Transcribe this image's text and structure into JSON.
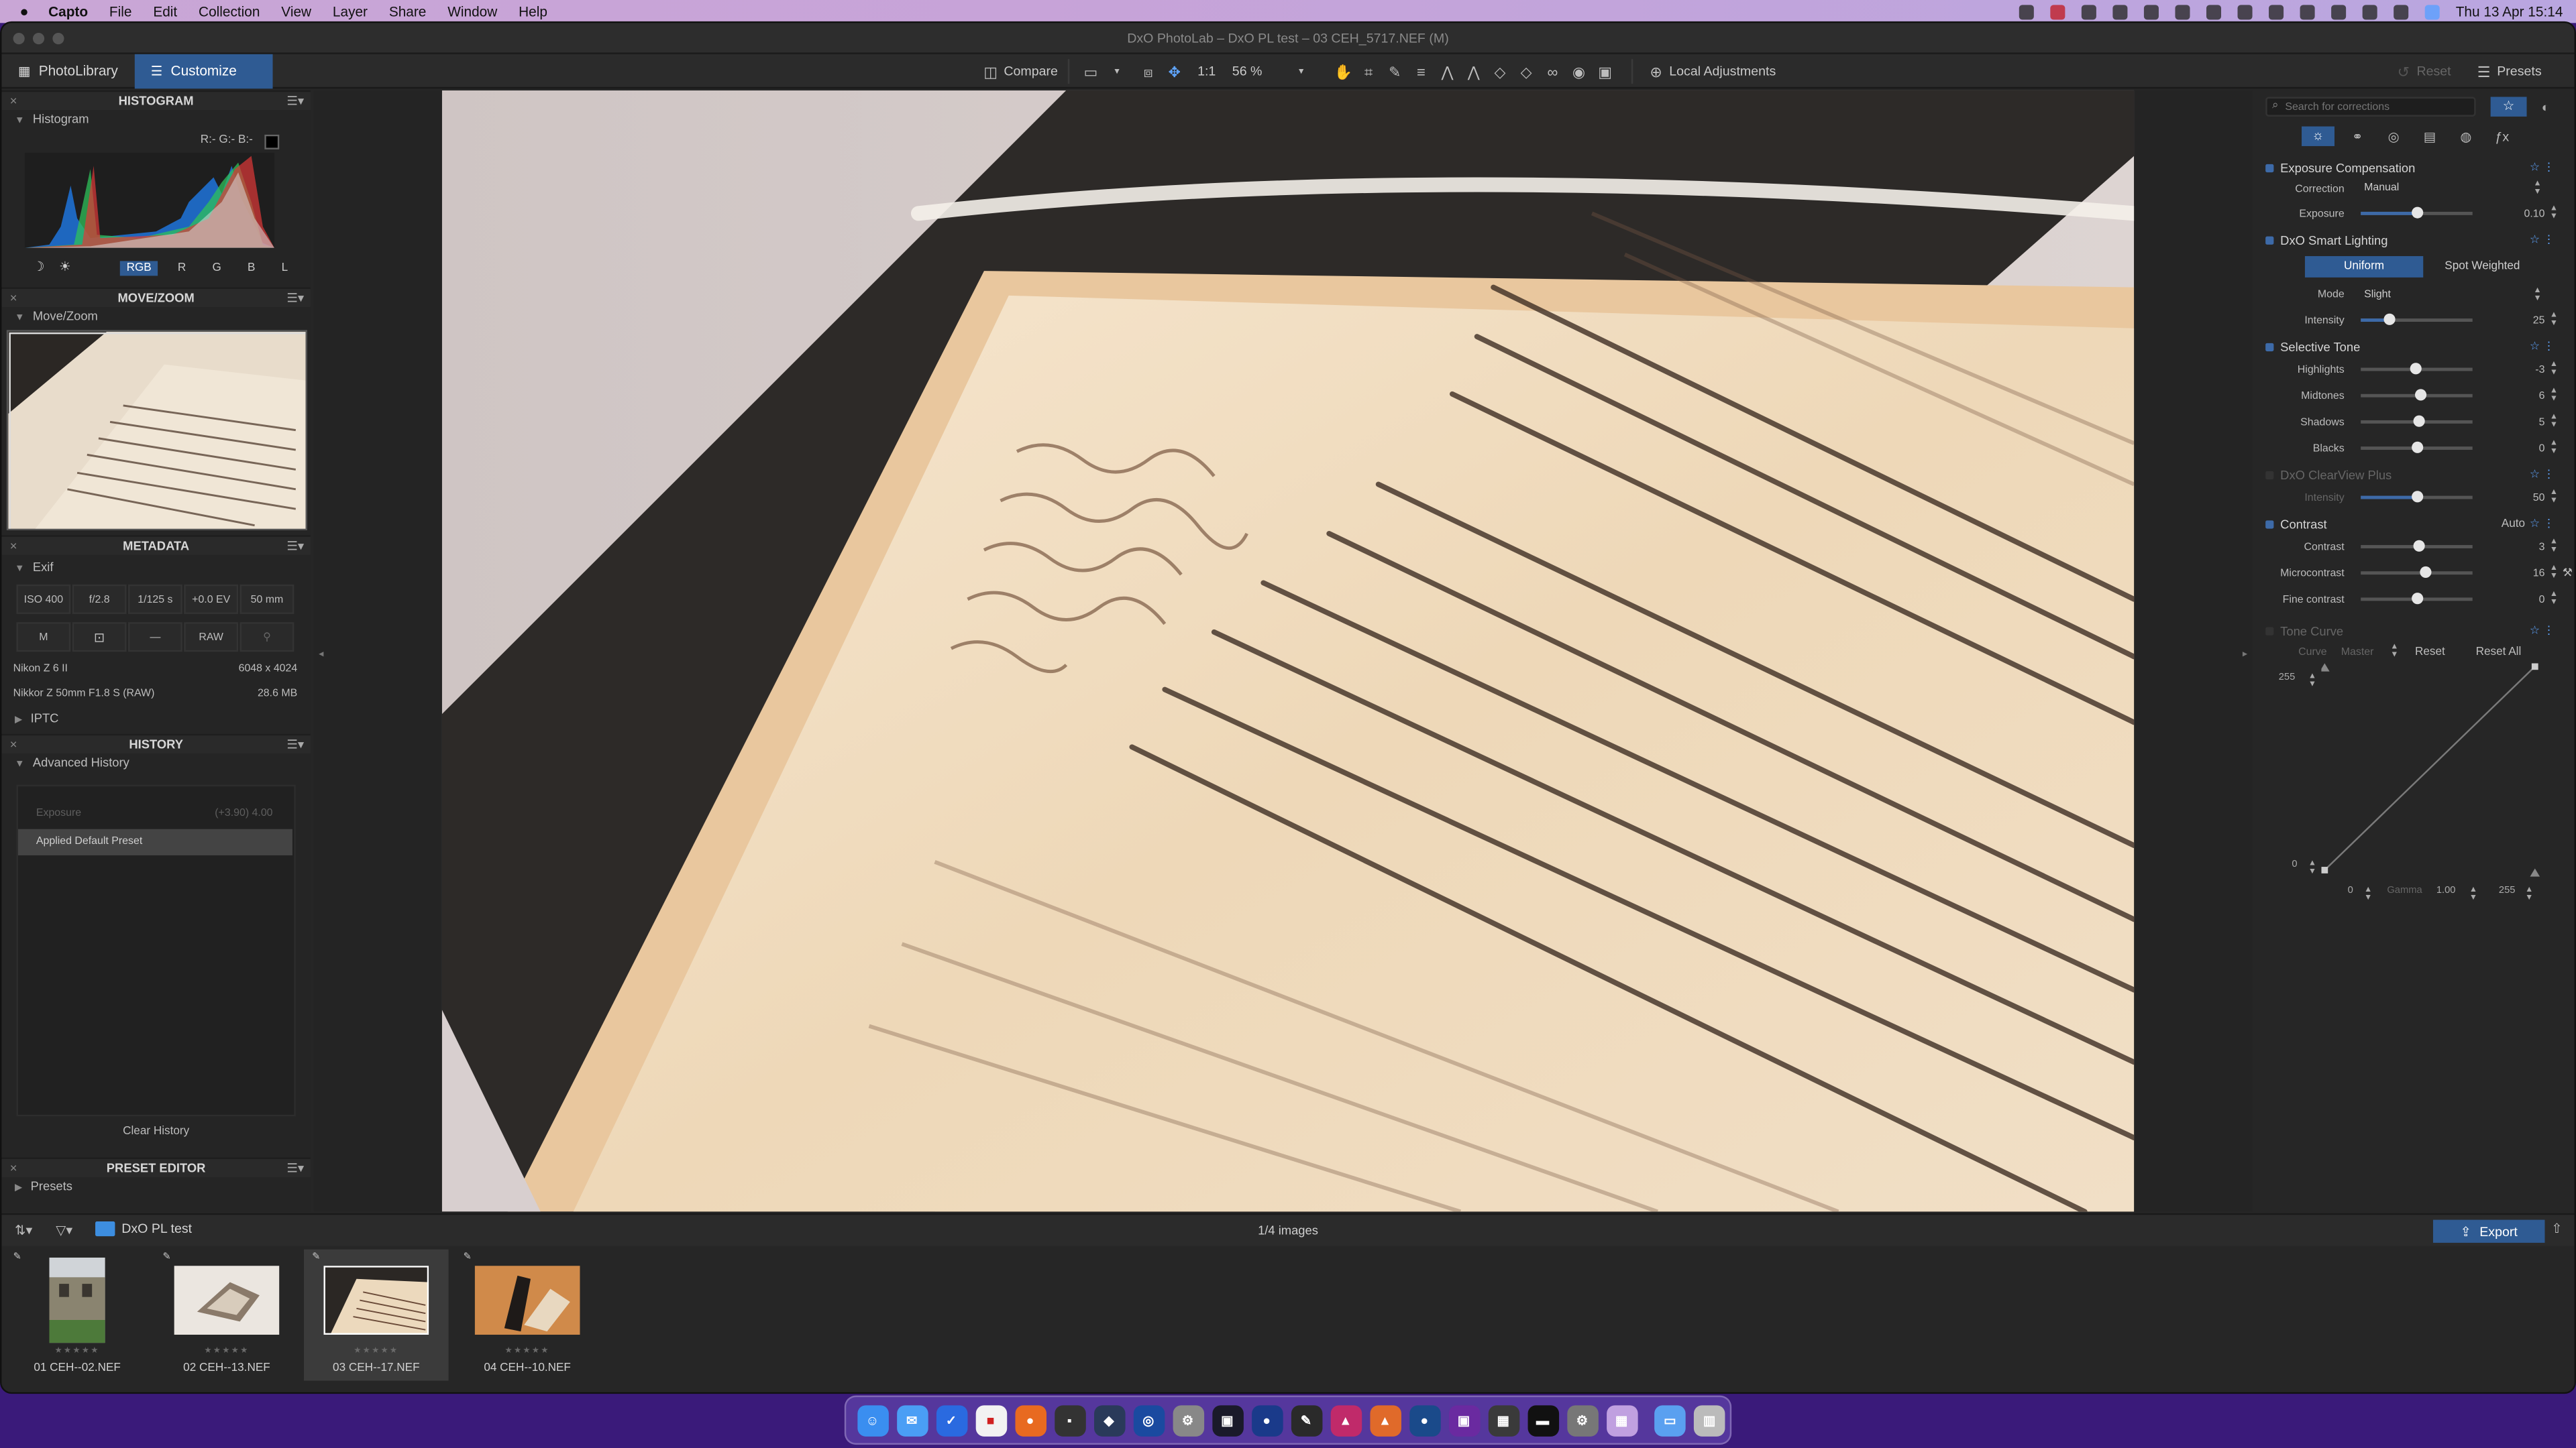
{
  "menubar": {
    "app": "Capto",
    "items": [
      "File",
      "Edit",
      "Collection",
      "View",
      "Layer",
      "Share",
      "Window",
      "Help"
    ],
    "clock": "Thu 13 Apr  15:14"
  },
  "window": {
    "title": "DxO PhotoLab – DxO PL test – 03 CEH_5717.NEF (M)"
  },
  "toolbar": {
    "tab_library": "PhotoLibrary",
    "tab_customize": "Customize",
    "compare": "Compare",
    "ratio": "1:1",
    "zoom": "56 %",
    "local_adjustments": "Local Adjustments",
    "reset": "Reset",
    "presets": "Presets"
  },
  "left": {
    "histogram_title": "HISTOGRAM",
    "histogram_sub": "Histogram",
    "rgb_readout": "R:- G:- B:-",
    "channels": [
      "RGB",
      "R",
      "G",
      "B",
      "L"
    ],
    "movezoom_title": "MOVE/ZOOM",
    "movezoom_sub": "Move/Zoom",
    "metadata_title": "METADATA",
    "exif_sub": "Exif",
    "exif_row1": [
      "ISO 400",
      "f/2.8",
      "1/125 s",
      "+0.0 EV",
      "50 mm"
    ],
    "exif_row2": [
      "M",
      "",
      "—",
      "RAW",
      ""
    ],
    "camera": "Nikon Z 6 II",
    "resolution": "6048 x 4024",
    "lens": "Nikkor Z 50mm F1.8 S (RAW)",
    "filesize": "28.6 MB",
    "iptc_sub": "IPTC",
    "history_title": "HISTORY",
    "advanced_history": "Advanced History",
    "hist_item1_label": "Exposure",
    "hist_item1_values": "(+3.90)  4.00",
    "hist_item2": "Applied Default Preset",
    "clear_history": "Clear History",
    "preset_editor_title": "PRESET EDITOR",
    "presets_sub": "Presets"
  },
  "right": {
    "search_placeholder": "Search for corrections",
    "exposure_comp": "Exposure Compensation",
    "correction_label": "Correction",
    "correction_value": "Manual",
    "exposure_label": "Exposure",
    "exposure_value": "0.10",
    "smart_lighting": "DxO Smart Lighting",
    "uniform": "Uniform",
    "spot_weighted": "Spot Weighted",
    "mode_label": "Mode",
    "mode_value": "Slight",
    "intensity_label": "Intensity",
    "intensity_value": "25",
    "selective_tone": "Selective Tone",
    "highlights_label": "Highlights",
    "highlights_value": "-3",
    "midtones_label": "Midtones",
    "midtones_value": "6",
    "shadows_label": "Shadows",
    "shadows_value": "5",
    "blacks_label": "Blacks",
    "blacks_value": "0",
    "clearview": "DxO ClearView Plus",
    "cv_intensity_label": "Intensity",
    "cv_intensity_value": "50",
    "contrast_title": "Contrast",
    "contrast_auto": "Auto",
    "contrast_label": "Contrast",
    "contrast_value": "3",
    "microcontrast_label": "Microcontrast",
    "microcontrast_value": "16",
    "finecontrast_label": "Fine contrast",
    "finecontrast_value": "0",
    "tone_curve": "Tone Curve",
    "curve_label": "Curve",
    "curve_value": "Master",
    "tc_reset": "Reset",
    "tc_reset_all": "Reset All",
    "tc_top": "255",
    "tc_bottom": "0",
    "tc_in_min": "0",
    "gamma_label": "Gamma",
    "gamma_value": "1.00",
    "tc_in_max": "255"
  },
  "filmstrip": {
    "folder": "DxO PL test",
    "count": "1/4 images",
    "export": "Export",
    "thumbs": [
      "01 CEH-‑02.NEF",
      "02 CEH-‑13.NEF",
      "03 CEH-‑17.NEF",
      "04 CEH-‑10.NEF"
    ]
  },
  "sliders": {
    "exposure": 0.5,
    "intensity": 0.25,
    "highlights": 0.49,
    "midtones": 0.53,
    "shadows": 0.52,
    "blacks": 0.5,
    "cv_intensity": 0.5,
    "contrast": 0.52,
    "microcontrast": 0.58,
    "finecontrast": 0.5
  },
  "colors": {
    "accent": "#2f5b93",
    "accent_light": "#5fa5ff"
  }
}
